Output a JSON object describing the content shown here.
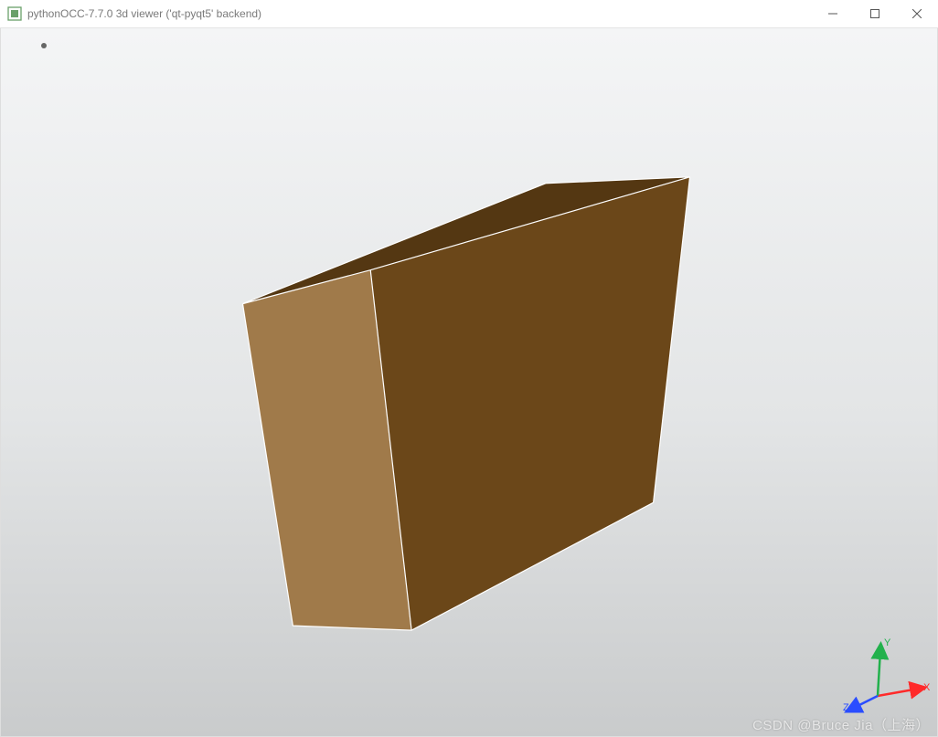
{
  "window": {
    "title": "pythonOCC-7.7.0 3d viewer ('qt-pyqt5' backend)",
    "icon_name": "app-icon"
  },
  "controls": {
    "minimize": "minimize",
    "maximize": "maximize",
    "close": "close"
  },
  "triad": {
    "x": "X",
    "y": "Y",
    "z": "Z",
    "x_color": "#ff2a2a",
    "y_color": "#22b14c",
    "z_color": "#2a4dff"
  },
  "scene": {
    "object": "box",
    "face_front": "#6b4719",
    "face_left": "#a07a4a",
    "face_top": "#543712",
    "edge": "#ffffff"
  },
  "watermark": "CSDN @Bruce Jia（上海）"
}
